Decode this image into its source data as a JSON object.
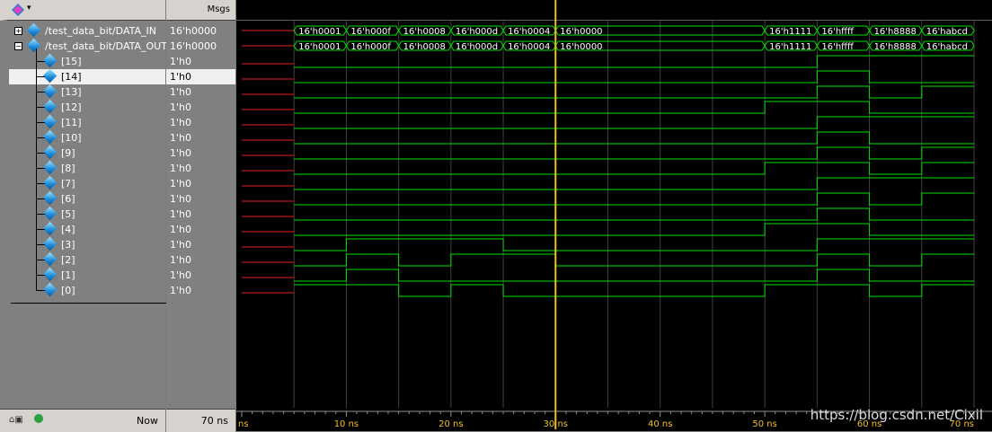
{
  "header": {
    "msgs_label": "Msgs"
  },
  "signals": [
    {
      "name": "/test_data_bit/DATA_IN",
      "value": "16'h0000",
      "expander": "+",
      "level": 0,
      "selected": false
    },
    {
      "name": "/test_data_bit/DATA_OUT",
      "value": "16'h0000",
      "expander": "−",
      "level": 0,
      "selected": false
    },
    {
      "name": "[15]",
      "value": "1'h0",
      "level": 1,
      "selected": false
    },
    {
      "name": "[14]",
      "value": "1'h0",
      "level": 1,
      "selected": true
    },
    {
      "name": "[13]",
      "value": "1'h0",
      "level": 1,
      "selected": false
    },
    {
      "name": "[12]",
      "value": "1'h0",
      "level": 1,
      "selected": false
    },
    {
      "name": "[11]",
      "value": "1'h0",
      "level": 1,
      "selected": false
    },
    {
      "name": "[10]",
      "value": "1'h0",
      "level": 1,
      "selected": false
    },
    {
      "name": "[9]",
      "value": "1'h0",
      "level": 1,
      "selected": false
    },
    {
      "name": "[8]",
      "value": "1'h0",
      "level": 1,
      "selected": false
    },
    {
      "name": "[7]",
      "value": "1'h0",
      "level": 1,
      "selected": false
    },
    {
      "name": "[6]",
      "value": "1'h0",
      "level": 1,
      "selected": false
    },
    {
      "name": "[5]",
      "value": "1'h0",
      "level": 1,
      "selected": false
    },
    {
      "name": "[4]",
      "value": "1'h0",
      "level": 1,
      "selected": false
    },
    {
      "name": "[3]",
      "value": "1'h0",
      "level": 1,
      "selected": false
    },
    {
      "name": "[2]",
      "value": "1'h0",
      "level": 1,
      "selected": false
    },
    {
      "name": "[1]",
      "value": "1'h0",
      "level": 1,
      "selected": false
    },
    {
      "name": "[0]",
      "value": "1'h0",
      "level": 1,
      "selected": false
    }
  ],
  "footer": {
    "now_label": "Now",
    "now_value": "70 ns"
  },
  "waveform": {
    "time_unit": "ns",
    "time_range": [
      0,
      70
    ],
    "cursor_time": 30,
    "tick_labels": [
      {
        "t": 0,
        "label": "ns"
      },
      {
        "t": 10,
        "label": "10 ns"
      },
      {
        "t": 20,
        "label": "20 ns"
      },
      {
        "t": 30,
        "label": "30 ns"
      },
      {
        "t": 40,
        "label": "40 ns"
      },
      {
        "t": 50,
        "label": "50 ns"
      },
      {
        "t": 60,
        "label": "60 ns"
      },
      {
        "t": 70,
        "label": "70 ns"
      }
    ],
    "bus_segments": [
      {
        "t0": 5,
        "t1": 10,
        "label": "16'h0001"
      },
      {
        "t0": 10,
        "t1": 15,
        "label": "16'h000f"
      },
      {
        "t0": 15,
        "t1": 20,
        "label": "16'h0008"
      },
      {
        "t0": 20,
        "t1": 25,
        "label": "16'h000d"
      },
      {
        "t0": 25,
        "t1": 30,
        "label": "16'h0004"
      },
      {
        "t0": 30,
        "t1": 50,
        "label": "16'h0000"
      },
      {
        "t0": 50,
        "t1": 55,
        "label": "16'h1111"
      },
      {
        "t0": 55,
        "t1": 60,
        "label": "16'hffff"
      },
      {
        "t0": 60,
        "t1": 65,
        "label": "16'h8888"
      },
      {
        "t0": 65,
        "t1": 70,
        "label": "16'habcd"
      }
    ],
    "undefined_until": 5,
    "colors": {
      "signal": "#00e000",
      "undefined": "#e02020",
      "cursor": "#f0c020",
      "grid": "#404040",
      "bus_text": "#ffffff"
    }
  },
  "watermark": "https://blog.csdn.net/Cixil"
}
